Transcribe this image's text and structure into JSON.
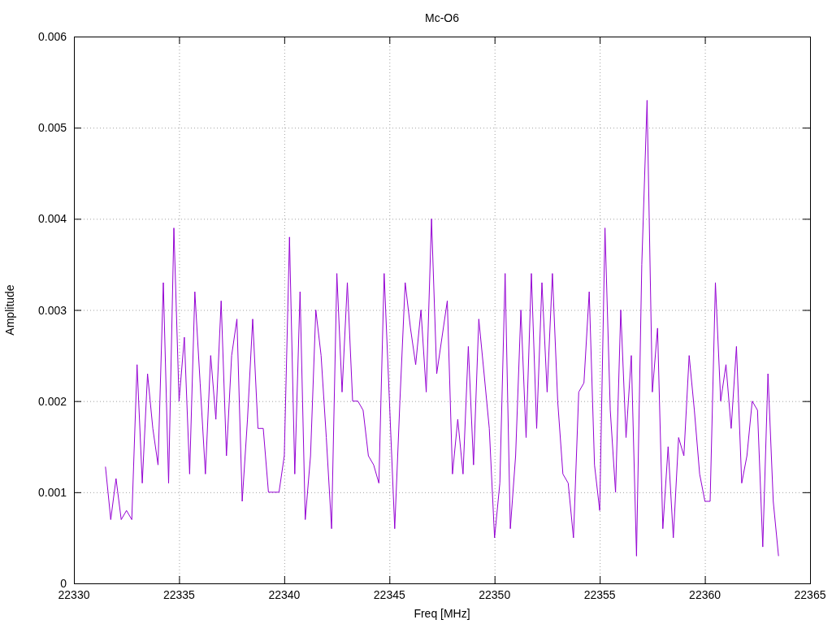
{
  "chart_data": {
    "type": "line",
    "title": "Mc-O6",
    "xlabel": "Freq [MHz]",
    "ylabel": "Amplitude",
    "xlim": [
      22330,
      22365
    ],
    "ylim": [
      0,
      0.006
    ],
    "xticks": [
      22330,
      22335,
      22340,
      22345,
      22350,
      22355,
      22360,
      22365
    ],
    "yticks": [
      {
        "value": 0,
        "label": "0"
      },
      {
        "value": 0.001,
        "label": "0.001"
      },
      {
        "value": 0.002,
        "label": "0.002"
      },
      {
        "value": 0.003,
        "label": "0.003"
      },
      {
        "value": 0.004,
        "label": "0.004"
      },
      {
        "value": 0.005,
        "label": "0.005"
      },
      {
        "value": 0.006,
        "label": "0.006"
      }
    ],
    "x": [
      22331.5,
      22331.75,
      22332,
      22332.25,
      22332.5,
      22332.75,
      22333,
      22333.25,
      22333.5,
      22333.75,
      22334,
      22334.25,
      22334.5,
      22334.75,
      22335,
      22335.25,
      22335.5,
      22335.75,
      22336,
      22336.25,
      22336.5,
      22336.75,
      22337,
      22337.25,
      22337.5,
      22337.75,
      22338,
      22338.25,
      22338.5,
      22338.75,
      22339,
      22339.25,
      22339.5,
      22339.75,
      22340,
      22340.25,
      22340.5,
      22340.75,
      22341,
      22341.25,
      22341.5,
      22341.75,
      22342,
      22342.25,
      22342.5,
      22342.75,
      22343,
      22343.25,
      22343.5,
      22343.75,
      22344,
      22344.25,
      22344.5,
      22344.75,
      22345,
      22345.25,
      22345.5,
      22345.75,
      22346,
      22346.25,
      22346.5,
      22346.75,
      22347,
      22347.25,
      22347.5,
      22347.75,
      22348,
      22348.25,
      22348.5,
      22348.75,
      22349,
      22349.25,
      22349.5,
      22349.75,
      22350,
      22350.25,
      22350.5,
      22350.75,
      22351,
      22351.25,
      22351.5,
      22351.75,
      22352,
      22352.25,
      22352.5,
      22352.75,
      22353,
      22353.25,
      22353.5,
      22353.75,
      22354,
      22354.25,
      22354.5,
      22354.75,
      22355,
      22355.25,
      22355.5,
      22355.75,
      22356,
      22356.25,
      22356.5,
      22356.75,
      22357,
      22357.25,
      22357.5,
      22357.75,
      22358,
      22358.25,
      22358.5,
      22358.75,
      22359,
      22359.25,
      22359.5,
      22359.75,
      22360,
      22360.25,
      22360.5,
      22360.75,
      22361,
      22361.25,
      22361.5,
      22361.75,
      22362,
      22362.25,
      22362.5,
      22362.75,
      22363,
      22363.25,
      22363.5
    ],
    "grid": true,
    "series": [
      {
        "color": "#9400d3",
        "values": [
          0.00128,
          0.0007,
          0.00115,
          0.0007,
          0.0008,
          0.0007,
          0.0024,
          0.0011,
          0.0023,
          0.0017,
          0.0013,
          0.0033,
          0.0011,
          0.0039,
          0.002,
          0.0027,
          0.0012,
          0.0032,
          0.0022,
          0.0012,
          0.0025,
          0.0018,
          0.0031,
          0.0014,
          0.0025,
          0.0029,
          0.0009,
          0.0018,
          0.0029,
          0.0017,
          0.0017,
          0.001,
          0.001,
          0.001,
          0.0014,
          0.0038,
          0.0012,
          0.0032,
          0.0007,
          0.0014,
          0.003,
          0.0025,
          0.0016,
          0.0006,
          0.0034,
          0.0021,
          0.0033,
          0.002,
          0.002,
          0.0019,
          0.0014,
          0.0013,
          0.0011,
          0.0034,
          0.002,
          0.0006,
          0.002,
          0.0033,
          0.0028,
          0.0024,
          0.003,
          0.0021,
          0.004,
          0.0023,
          0.0027,
          0.0031,
          0.0012,
          0.0018,
          0.0012,
          0.0026,
          0.0013,
          0.0029,
          0.0023,
          0.0017,
          0.0005,
          0.0011,
          0.0034,
          0.0006,
          0.0014,
          0.003,
          0.0016,
          0.0034,
          0.0017,
          0.0033,
          0.0021,
          0.0034,
          0.002,
          0.0012,
          0.0011,
          0.0005,
          0.0021,
          0.0022,
          0.0032,
          0.0013,
          0.0008,
          0.0039,
          0.0019,
          0.001,
          0.003,
          0.0016,
          0.0025,
          0.0003,
          0.0035,
          0.0053,
          0.0021,
          0.0028,
          0.0006,
          0.0015,
          0.0005,
          0.0016,
          0.0014,
          0.0025,
          0.0019,
          0.0012,
          0.0009,
          0.0009,
          0.0033,
          0.002,
          0.0024,
          0.0017,
          0.0026,
          0.0011,
          0.0014,
          0.002,
          0.0019,
          0.0004,
          0.0023,
          0.0009,
          0.0003
        ]
      }
    ]
  }
}
